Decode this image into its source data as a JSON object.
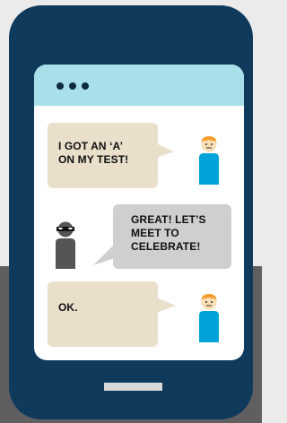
{
  "colors": {
    "phone_body": "#0f3a5c",
    "screen": "#ffffff",
    "screen_header": "#a9dfe8",
    "bubble_incoming": "#e9dfcb",
    "bubble_outgoing": "#cfcfd1",
    "person_shirt": "#00a3d9",
    "person_hair": "#f39c2b",
    "masked_person": "#555555"
  },
  "header": {
    "dots_icon": "three-dots-icon"
  },
  "messages": [
    {
      "sender": "kid",
      "text": "I GOT AN ‘A’\nON MY TEST!"
    },
    {
      "sender": "masked-stranger",
      "text": "GREAT! LET’S\nMEET TO\nCELEBRATE!"
    },
    {
      "sender": "kid",
      "text": "OK."
    }
  ]
}
